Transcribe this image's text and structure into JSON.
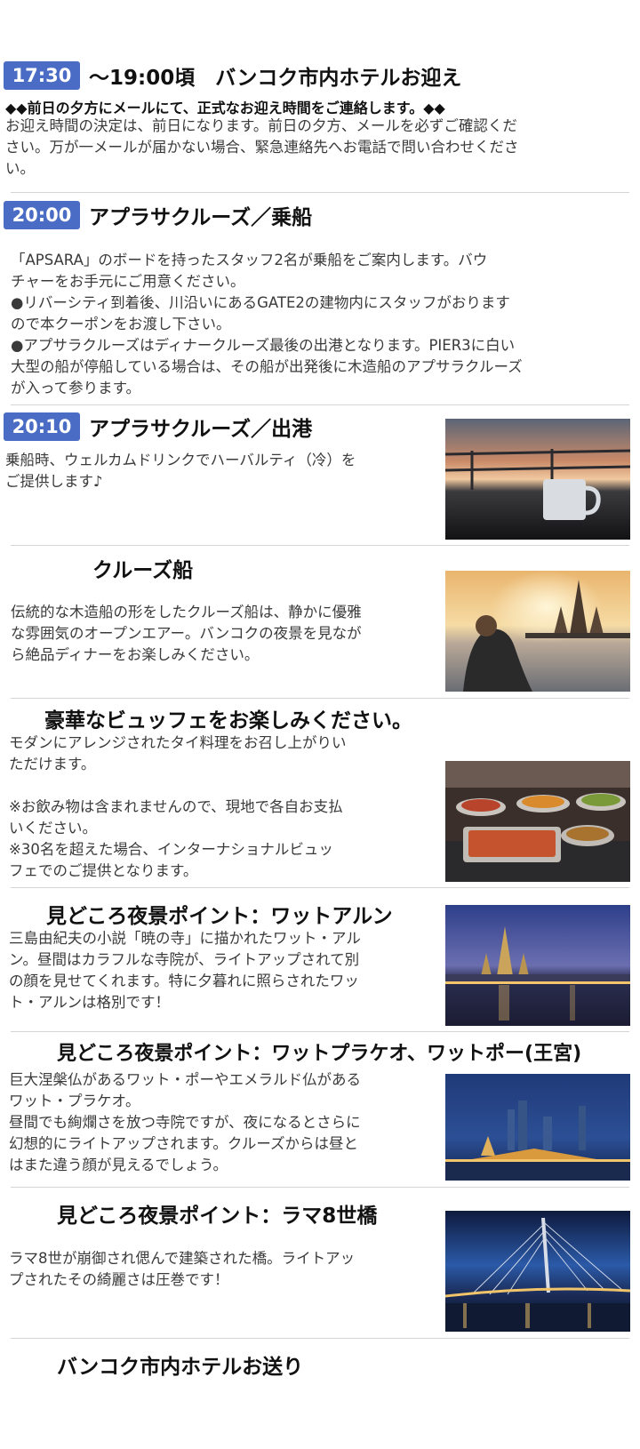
{
  "s1": {
    "time": "17:30",
    "title": "～19:00頃　バンコク市内ホテルお迎え",
    "note": "◆◆前日の夕方にメールにて、正式なお迎え時間をご連絡します。◆◆",
    "lines": [
      "お迎え時間の決定は、前日になります。前日の夕方、メールを必ずご確認くだ",
      "さい。万が一メールが届かない場合、緊急連絡先へお電話で問い合わせくださ",
      "い。"
    ]
  },
  "s2": {
    "time": "20:00",
    "title": "アプラサクルーズ／乗船",
    "lines": [
      "「APSARA」のボードを持ったスタッフ2名が乗船をご案内します。バウ",
      "チャーをお手元にご用意ください。",
      "●リバーシティ到着後、川沿いにあるGATE2の建物内にスタッフがおります",
      "ので本クーポンをお渡し下さい。",
      "●アプサラクルーズはディナークルーズ最後の出港となります。PIER3に白い",
      "大型の船が停船している場合は、その船が出発後に木造船のアプサラクルーズ",
      "が入って参ります。"
    ]
  },
  "s3": {
    "time": "20:10",
    "title": "アプラサクルーズ／出港",
    "lines": [
      "乗船時、ウェルカムドリンクでハーバルティ（冷）を",
      "ご提供します♪"
    ]
  },
  "s4": {
    "title": "クルーズ船",
    "lines": [
      "伝統的な木造船の形をしたクルーズ船は、静かに優雅",
      "な雰囲気のオープンエアー。バンコクの夜景を見なが",
      "ら絶品ディナーをお楽しみください。"
    ]
  },
  "s5": {
    "title": "豪華なビュッフェをお楽しみください。",
    "lines": [
      "モダンにアレンジされたタイ料理をお召し上がりい",
      "ただけます。",
      "",
      "※お飲み物は含まれませんので、現地で各自お支払",
      "いください。",
      "※30名を超えた場合、インターナショナルビュッ",
      "フェでのご提供となります。"
    ]
  },
  "s6": {
    "title": "見どころ夜景ポイント：ワットアルン",
    "lines": [
      "三島由紀夫の小説「暁の寺」に描かれたワット・アル",
      "ン。昼間はカラフルな寺院が、ライトアップされて別",
      "の顔を見せてくれます。特に夕暮れに照らされたワッ",
      "ト・アルンは格別です！"
    ]
  },
  "s7": {
    "title": "見どころ夜景ポイント：ワットプラケオ、ワットポー(王宮)",
    "lines": [
      "巨大涅槃仏があるワット・ポーやエメラルド仏がある",
      "ワット・プラケオ。",
      "昼間でも絢爛さを放つ寺院ですが、夜になるとさらに",
      "幻想的にライトアップされます。クルーズからは昼と",
      "はまた違う顔が見えるでしょう。"
    ]
  },
  "s8": {
    "title": "見どころ夜景ポイント：ラマ8世橋",
    "lines": [
      "ラマ8世が崩御され偲んで建築された橋。ライトアッ",
      "プされたその綺麗さは圧巻です！"
    ]
  },
  "s9": {
    "title": "バンコク市内ホテルお送り"
  },
  "colors": {
    "badge": "#4a6cc4",
    "divider": "#d4d4d4"
  }
}
